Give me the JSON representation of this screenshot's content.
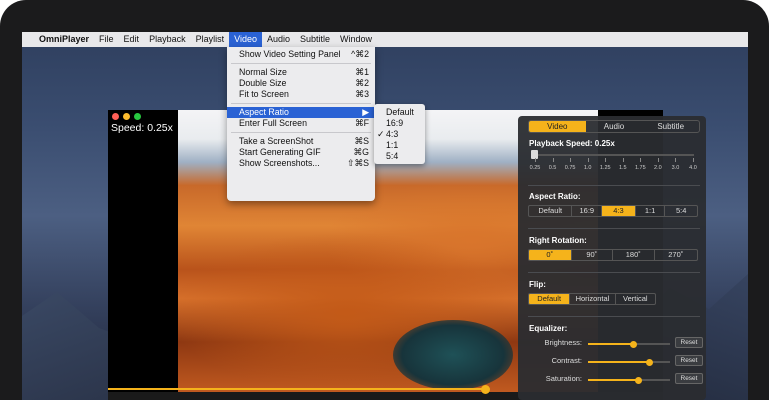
{
  "menubar": {
    "apple_icon": "",
    "app_name": "OmniPlayer",
    "items": [
      "File",
      "Edit",
      "Playback",
      "Playlist",
      "Video",
      "Audio",
      "Subtitle",
      "Window"
    ],
    "active": "Video"
  },
  "video_menu": {
    "items": [
      {
        "label": "Show Video Setting Panel",
        "shortcut": "^⌘2"
      },
      {
        "label": "Normal Size",
        "shortcut": "⌘1"
      },
      {
        "label": "Double Size",
        "shortcut": "⌘2"
      },
      {
        "label": "Fit to Screen",
        "shortcut": "⌘3"
      },
      {
        "label": "Aspect Ratio",
        "shortcut": "▶"
      },
      {
        "label": "Enter Full Screen",
        "shortcut": "⌘F"
      },
      {
        "label": "Take a ScreenShot",
        "shortcut": "⌘S"
      },
      {
        "label": "Start Generating GIF",
        "shortcut": "⌘G"
      },
      {
        "label": "Show Screenshots...",
        "shortcut": "⇧⌘S"
      }
    ],
    "highlighted": "Aspect Ratio"
  },
  "aspect_submenu": {
    "items": [
      "Default",
      "16:9",
      "4:3",
      "1:1",
      "5:4"
    ],
    "checked": "4:3",
    "check_glyph": "✓"
  },
  "player": {
    "speed_label": "Speed: 0.25x",
    "progress": 0.68
  },
  "panel": {
    "tabs": [
      "Video",
      "Audio",
      "Subtitle"
    ],
    "active_tab": "Video",
    "playback_speed_title": "Playback Speed: 0.25x",
    "speed_ticks": [
      "0.25",
      "0.5",
      "0.75",
      "1.0",
      "1.25",
      "1.5",
      "1.75",
      "2.0",
      "3.0",
      "4.0"
    ],
    "aspect_title": "Aspect Ratio:",
    "aspect_options": [
      "Default",
      "16:9",
      "4:3",
      "1:1",
      "5:4"
    ],
    "aspect_selected": "4:3",
    "rotation_title": "Right Rotation:",
    "rotation_options": [
      "0˚",
      "90˚",
      "180˚",
      "270˚"
    ],
    "rotation_selected": "0˚",
    "flip_title": "Flip:",
    "flip_options": [
      "Default",
      "Horizontal",
      "Vertical"
    ],
    "flip_selected": "Default",
    "equalizer_title": "Equalizer:",
    "equalizer": [
      {
        "label": "Brightness:",
        "level": 0.55,
        "reset": "Reset"
      },
      {
        "label": "Contrast:",
        "level": 0.75,
        "reset": "Reset"
      },
      {
        "label": "Saturation:",
        "level": 0.62,
        "reset": "Reset"
      }
    ]
  },
  "colors": {
    "accent": "#f5b31b",
    "menu_highlight": "#2a62d4"
  }
}
